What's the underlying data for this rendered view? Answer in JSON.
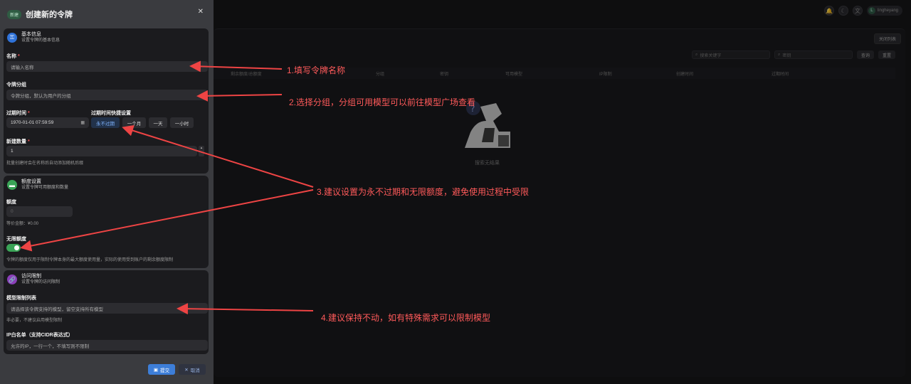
{
  "topbar": {
    "user": "lingheyang",
    "user_initial": "L"
  },
  "list": {
    "close_list": "关闭列表",
    "search_keyword_placeholder": "搜索关键字",
    "search_key_placeholder": "密钥",
    "query_btn": "查询",
    "reset_btn": "重置",
    "columns": [
      "剩余额度/总额度",
      "分组",
      "密钥",
      "可用模型",
      "IP限制",
      "创建时间",
      "过期时间"
    ],
    "empty_text": "搜索无结果"
  },
  "drawer": {
    "tag": "新建",
    "title": "创建新的令牌",
    "basic": {
      "title": "基本信息",
      "subtitle": "设置令牌的基本信息",
      "name_label": "名称",
      "name_placeholder": "请输入名称",
      "group_label": "令牌分组",
      "group_placeholder": "令牌分组，默认为用户的分组",
      "expire_label": "过期时间",
      "expire_value": "1970-01-01 07:59:59",
      "quick_label": "过期时间快捷设置",
      "quick_options": [
        "永不过期",
        "一个月",
        "一天",
        "一小时"
      ],
      "count_label": "新建数量",
      "count_value": "1",
      "count_hint": "批量创建时会在名称后自动添加随机后缀"
    },
    "quota": {
      "title": "额度设置",
      "subtitle": "设置令牌可用额度和数量",
      "quota_label": "额度",
      "quota_value": "0",
      "equiv": "等价金额：¥0.00",
      "unlimited_label": "无限额度",
      "unlimited_hint": "令牌的额度仅用于限制令牌本身的最大额度使用量，实际的使用受到账户的剩余额度限制"
    },
    "access": {
      "title": "访问限制",
      "subtitle": "设置令牌的访问限制",
      "models_label": "模型限制列表",
      "models_placeholder": "请选择该令牌支持的模型，留空支持所有模型",
      "models_hint": "非必要，不建议启用模型限制",
      "ip_label": "IP白名单（支持CIDR表达式）",
      "ip_placeholder": "允许的IP，一行一个，不填写则不限制"
    },
    "submit": "提交",
    "cancel": "取消"
  },
  "annotations": {
    "a1": "1.填写令牌名称",
    "a2": "2.选择分组，分组可用模型可以前往模型广场查看",
    "a3": "3.建议设置为永不过期和无限额度，避免使用过程中受限",
    "a4": "4.建议保持不动，如有特殊需求可以限制模型"
  },
  "colors": {
    "annotation": "#ff5a5a",
    "toggle_on": "#3aa457",
    "primary": "#3d7ed8"
  }
}
